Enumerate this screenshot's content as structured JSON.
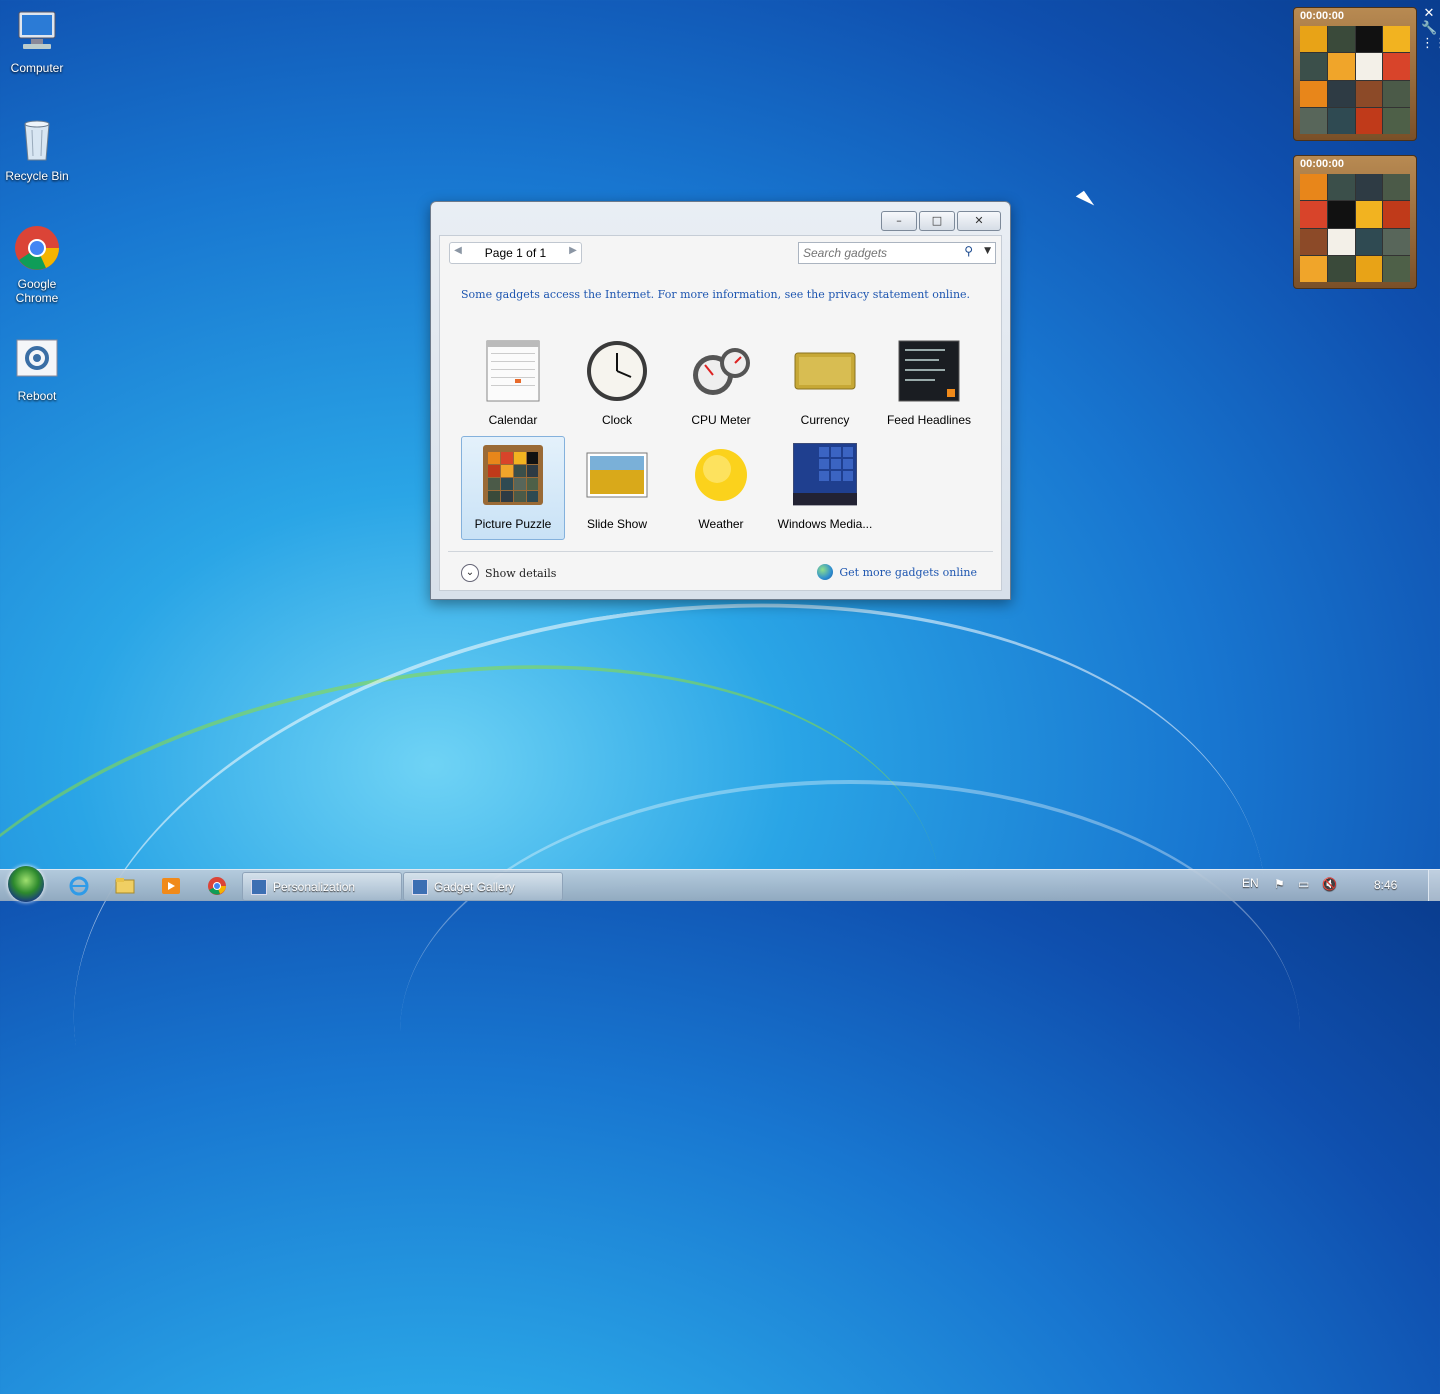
{
  "desktop": {
    "icons": [
      {
        "label": "Computer",
        "icon": "computer-icon"
      },
      {
        "label": "Recycle Bin",
        "icon": "recycle-bin-icon"
      },
      {
        "label": "Google Chrome",
        "icon": "chrome-icon"
      },
      {
        "label": "Reboot",
        "icon": "reboot-icon"
      }
    ]
  },
  "puzzle_gadgets": [
    {
      "timer": "00:00:00"
    },
    {
      "timer": "00:00:00"
    }
  ],
  "window": {
    "minimize": "–",
    "maximize": "□",
    "close": "✕",
    "nav": {
      "page_label": "Page 1 of 1"
    },
    "search": {
      "placeholder": "Search gadgets"
    },
    "notice": "Some gadgets access the Internet.  For more information, see the privacy statement online.",
    "gadgets": [
      {
        "name": "Calendar",
        "icon": "calendar-icon"
      },
      {
        "name": "Clock",
        "icon": "clock-icon"
      },
      {
        "name": "CPU Meter",
        "icon": "cpu-meter-icon"
      },
      {
        "name": "Currency",
        "icon": "currency-icon"
      },
      {
        "name": "Feed Headlines",
        "icon": "feed-headlines-icon"
      },
      {
        "name": "Picture Puzzle",
        "icon": "picture-puzzle-icon",
        "selected": true
      },
      {
        "name": "Slide Show",
        "icon": "slide-show-icon"
      },
      {
        "name": "Weather",
        "icon": "weather-icon"
      },
      {
        "name": "Windows Media...",
        "icon": "windows-media-icon"
      }
    ],
    "show_details": "Show details",
    "get_more": "Get more gadgets online"
  },
  "taskbar": {
    "tasks": [
      {
        "label": "Personalization"
      },
      {
        "label": "Gadget Gallery"
      }
    ],
    "tray": {
      "language": "EN",
      "time": "8:46"
    }
  }
}
